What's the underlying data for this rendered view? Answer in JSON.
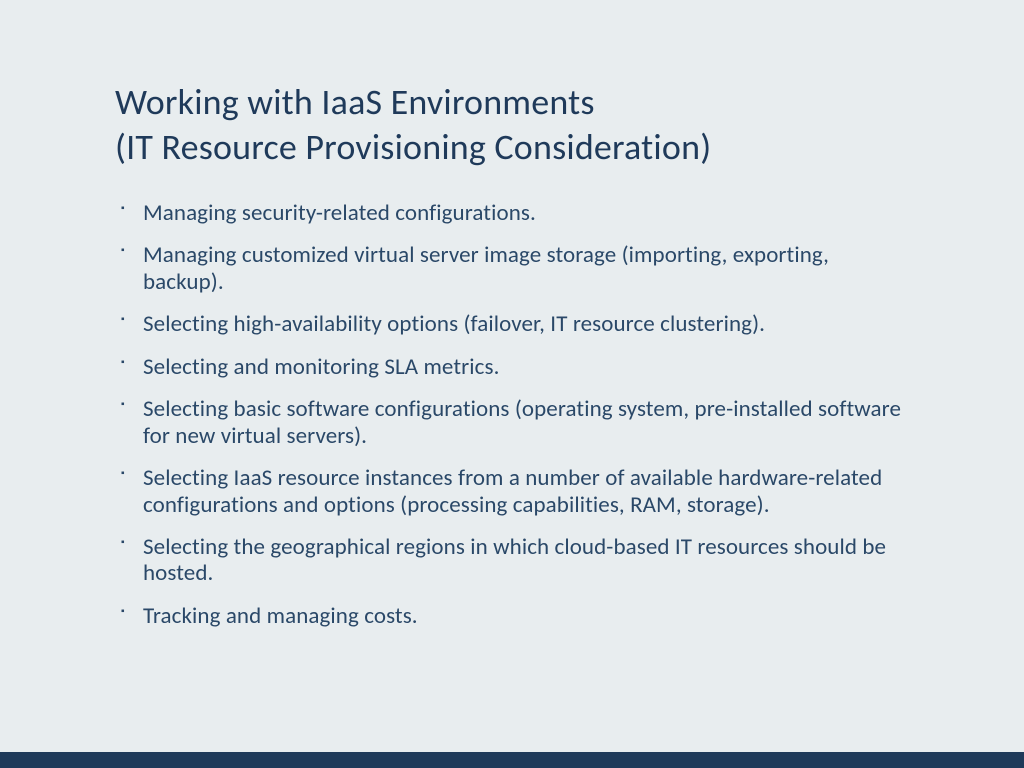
{
  "title_line1": "Working with IaaS Environments",
  "title_line2": "(IT Resource Provisioning Consideration)",
  "bullets": [
    "Managing security-related configurations.",
    "Managing customized virtual server image storage (importing, exporting, backup).",
    "Selecting high-availability options (failover, IT resource clustering).",
    "Selecting and monitoring SLA metrics.",
    "Selecting basic software configurations (operating system, pre-installed software for new virtual servers).",
    "Selecting IaaS resource instances from a number of available hardware-related configurations and options (processing capabilities, RAM, storage).",
    "Selecting the geographical regions in which cloud-based IT resources should be hosted.",
    "Tracking and managing costs."
  ]
}
